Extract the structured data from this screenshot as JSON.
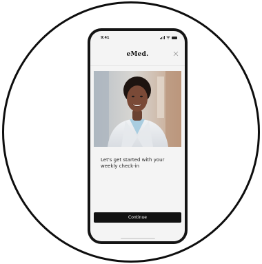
{
  "status_bar": {
    "time": "9:41",
    "icons": [
      "signal-icon",
      "wifi-icon",
      "battery-icon"
    ]
  },
  "header": {
    "logo": "eMed.",
    "close_icon": "close-icon"
  },
  "hero_image": {
    "subject": "smiling doctor in white coat"
  },
  "main": {
    "message": "Let's get started with your weekly check-in"
  },
  "footer": {
    "continue_label": "Continue"
  },
  "colors": {
    "button_bg": "#111111",
    "button_text": "#ffffff",
    "frame": "#141414",
    "screen_bg": "#f4f4f4"
  }
}
